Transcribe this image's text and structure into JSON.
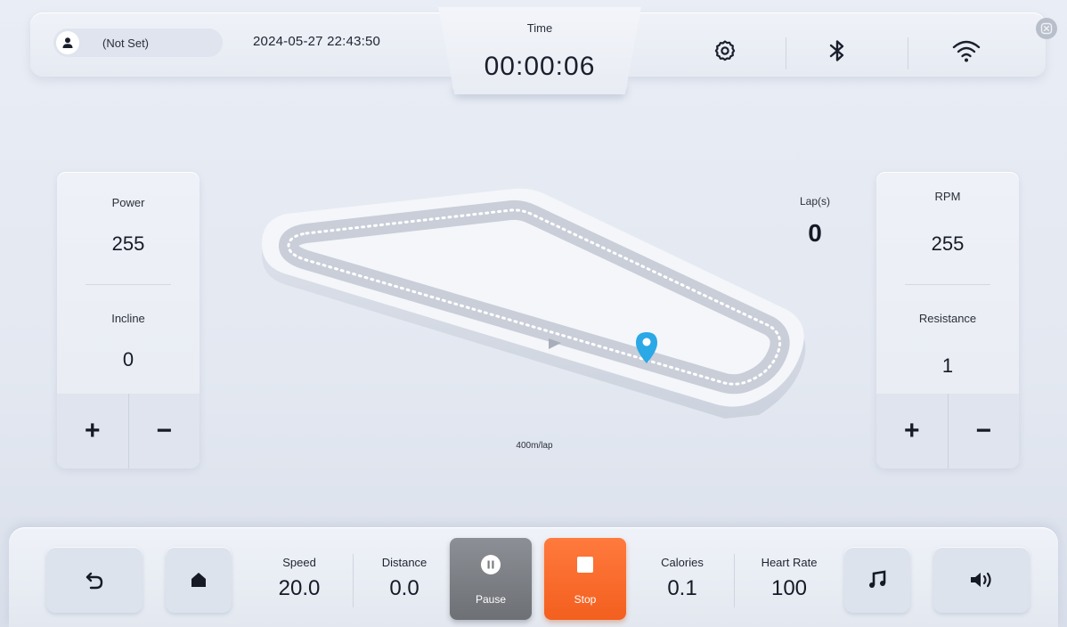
{
  "header": {
    "user_name": "(Not Set)",
    "datetime": "2024-05-27 22:43:50",
    "time_label": "Time",
    "time_value": "00:00:06",
    "icons": [
      "user-icon",
      "gear-icon",
      "bluetooth-icon",
      "wifi-icon",
      "close-icon"
    ]
  },
  "left_panel": {
    "power_label": "Power",
    "power_value": "255",
    "incline_label": "Incline",
    "incline_value": "0",
    "plus": "+",
    "minus": "−"
  },
  "right_panel": {
    "rpm_label": "RPM",
    "rpm_value": "255",
    "resistance_label": "Resistance",
    "resistance_value": "1",
    "plus": "+",
    "minus": "−"
  },
  "track": {
    "laps_label": "Lap(s)",
    "laps_value": "0",
    "lap_note": "400m/lap",
    "marker_color": "#2ba8e6"
  },
  "footer": {
    "speed_label": "Speed",
    "speed_value": "20.0",
    "distance_label": "Distance",
    "distance_value": "0.0",
    "pause_label": "Pause",
    "stop_label": "Stop",
    "calories_label": "Calories",
    "calories_value": "0.1",
    "heart_rate_label": "Heart Rate",
    "heart_rate_value": "100",
    "icons": [
      "back-icon",
      "home-icon",
      "music-icon",
      "volume-icon"
    ]
  },
  "colors": {
    "stop": "#f35f1e",
    "pause": "#7a7d83",
    "background": "#e6eaf2"
  }
}
